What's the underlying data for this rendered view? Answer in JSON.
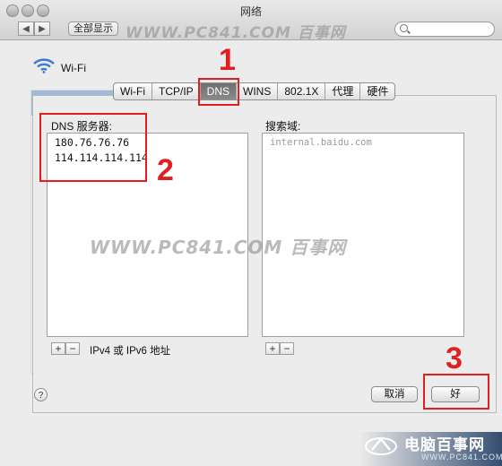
{
  "window": {
    "title": "网络"
  },
  "toolbar": {
    "show_all_label": "全部显示",
    "back": "◀",
    "forward": "▶"
  },
  "watermarks": {
    "top": "WWW.PC841.COM 百事网",
    "middle": "WWW.PC841.COM 百事网"
  },
  "wifi": {
    "label": "Wi-Fi"
  },
  "tabs": [
    {
      "label": "Wi-Fi"
    },
    {
      "label": "TCP/IP"
    },
    {
      "label": "DNS"
    },
    {
      "label": "WINS"
    },
    {
      "label": "802.1X"
    },
    {
      "label": "代理"
    },
    {
      "label": "硬件"
    }
  ],
  "dns": {
    "servers_label": "DNS 服务器:",
    "servers": [
      "180.76.76.76",
      "114.114.114.114"
    ],
    "hint": "IPv4 或 IPv6 地址"
  },
  "search_domains": {
    "label": "搜索域:",
    "items": [
      "internal.baidu.com"
    ]
  },
  "buttons": {
    "add": "+",
    "remove": "−",
    "help": "?",
    "cancel": "取消",
    "ok": "好"
  },
  "steps": {
    "one": "1",
    "two": "2",
    "three": "3"
  },
  "branding": {
    "name": "电脑百事网",
    "url": "WWW.PC841.COM"
  },
  "colors": {
    "annotation": "#e02020",
    "selected_tab": "#7a7a7a"
  }
}
